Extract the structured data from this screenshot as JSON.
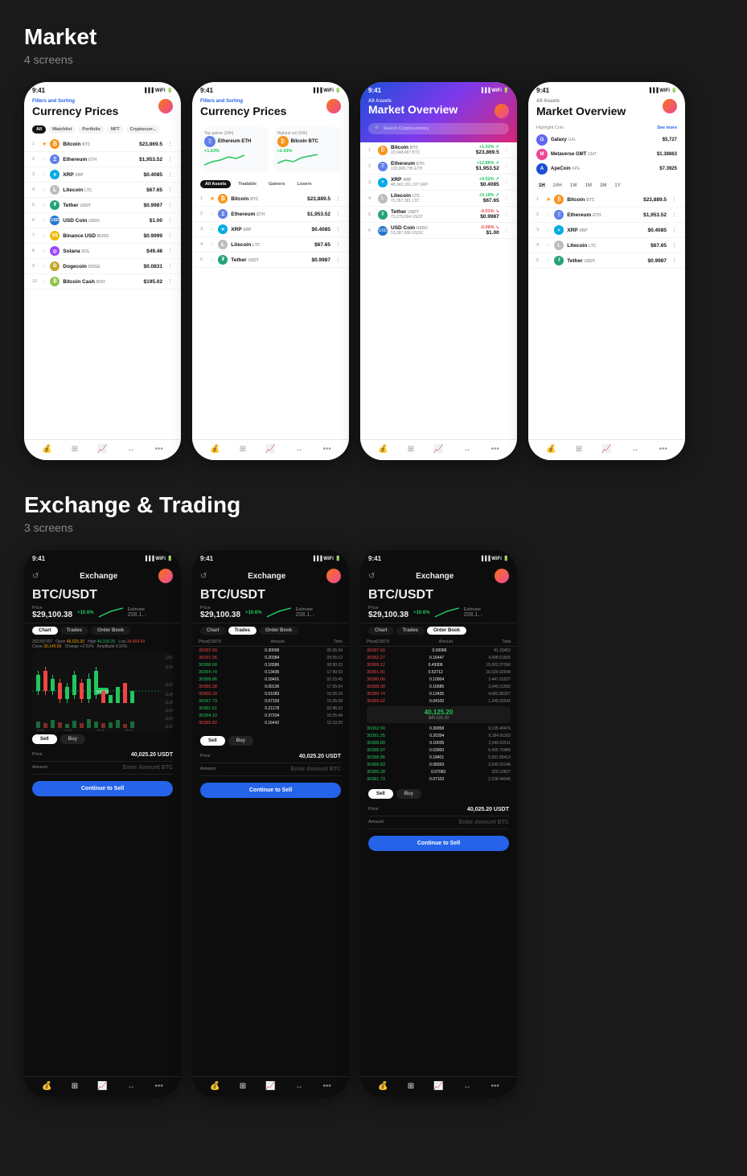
{
  "market": {
    "section_title": "Market",
    "section_subtitle": "4 screens",
    "screen1": {
      "time": "9:41",
      "filters_label": "Filters and Sorting",
      "title": "Currency Prices",
      "tabs": [
        "All",
        "Watchlist",
        "Portfolio",
        "NFT",
        "Cryptocurr..."
      ],
      "active_tab": "All",
      "coins": [
        {
          "num": 1,
          "star": true,
          "name": "Bitcoin",
          "ticker": "BTC",
          "price": "$23,869.5",
          "color": "btc"
        },
        {
          "num": 2,
          "star": false,
          "name": "Ethereum",
          "ticker": "ETH",
          "price": "$1,953.52",
          "color": "eth"
        },
        {
          "num": 3,
          "star": false,
          "name": "XRP",
          "ticker": "XRP",
          "price": "$0.4085",
          "color": "xrp"
        },
        {
          "num": 4,
          "star": false,
          "name": "Litecoin",
          "ticker": "LTC",
          "price": "$67.65",
          "color": "ltc"
        },
        {
          "num": 5,
          "star": false,
          "name": "Tether",
          "ticker": "USDT",
          "price": "$0.9987",
          "color": "usdt"
        },
        {
          "num": 6,
          "star": false,
          "name": "USD Coin",
          "ticker": "USDC",
          "price": "$1.00",
          "color": "usdc"
        },
        {
          "num": 7,
          "star": false,
          "name": "Binance USD",
          "ticker": "BUSD",
          "price": "$0.9999",
          "color": "busd"
        },
        {
          "num": 8,
          "star": false,
          "name": "Solana",
          "ticker": "SOL",
          "price": "$49.48",
          "color": "sol"
        },
        {
          "num": 9,
          "star": false,
          "name": "Dogecoin",
          "ticker": "DOGE",
          "price": "$0.0831",
          "color": "doge"
        },
        {
          "num": 10,
          "star": false,
          "name": "Bitcoin Cash",
          "ticker": "BCH",
          "price": "$195.02",
          "color": "bch"
        }
      ]
    },
    "screen2": {
      "time": "9:41",
      "filters_label": "Filters and Sorting",
      "title": "Currency Prices",
      "gainer_label": "Top gainer (24h)",
      "highest_vol_label": "Highest vol (24h)",
      "gainer": {
        "name": "Ethereum",
        "ticker": "ETH",
        "change": "+1.53%"
      },
      "highest_vol": {
        "name": "Bitcoin",
        "ticker": "BTC",
        "change": "+2.43%"
      },
      "filter_tabs": [
        "All Assets",
        "Tradable",
        "Gainers",
        "Losers"
      ],
      "active_filter": "All Assets",
      "coins": [
        {
          "num": 1,
          "star": true,
          "name": "Bitcoin",
          "ticker": "BTC",
          "price": "$23,889.5"
        },
        {
          "num": 2,
          "star": false,
          "name": "Ethereum",
          "ticker": "ETH",
          "price": "$1,953.52"
        },
        {
          "num": 3,
          "star": false,
          "name": "XRP",
          "ticker": "XRP",
          "price": "$0.4085"
        },
        {
          "num": 4,
          "star": false,
          "name": "Litecoin",
          "ticker": "LTC",
          "price": "$67.65"
        },
        {
          "num": 5,
          "star": false,
          "name": "Tether",
          "ticker": "USDT",
          "price": "$0.9987"
        }
      ]
    },
    "screen3": {
      "time": "9:41",
      "all_assets_label": "All Assets",
      "title": "Market Overview",
      "search_placeholder": "Search Cryptocurrency",
      "coins": [
        {
          "num": 1,
          "name": "Bitcoin",
          "ticker": "BTC",
          "supply": "19,048,487 BTC",
          "price": "$23,869.5",
          "change": "+1.53%"
        },
        {
          "num": 2,
          "name": "Ethereum",
          "ticker": "ETH",
          "supply": "120,908,795 ETH",
          "price": "$1,953.52",
          "change": "+12.86%"
        },
        {
          "num": 3,
          "name": "XRP",
          "ticker": "XRP",
          "supply": "48,343,101,197 XRP",
          "price": "$0.4085",
          "change": "+9.52%"
        },
        {
          "num": 4,
          "name": "Litecoin",
          "ticker": "LTC",
          "supply": "70,357,381 LTC",
          "price": "$67.65",
          "change": "+5.18%"
        },
        {
          "num": 5,
          "name": "Tether",
          "ticker": "USDT",
          "supply": "73,275,094 USDT",
          "price": "$0.9987",
          "change": "-0.01%"
        },
        {
          "num": 6,
          "name": "USD Coin",
          "ticker": "USDC",
          "supply": "53,287,606 USDC",
          "price": "$1.00",
          "change": "-0.06%"
        }
      ]
    },
    "screen4": {
      "time": "9:41",
      "all_assets_label": "All Assets",
      "title": "Market Overview",
      "highlight_label": "Highlight Coin",
      "see_more": "See more",
      "highlights": [
        {
          "name": "Galaxy",
          "ticker": "GAL",
          "price": "$5,727",
          "color": "gal"
        },
        {
          "name": "Metaverse GMT",
          "ticker": "GMT",
          "price": "$1.38863",
          "color": "mtv"
        },
        {
          "name": "ApeCoin",
          "ticker": "APE",
          "price": "$7.3925",
          "color": "ape"
        }
      ],
      "time_tabs": [
        "1H",
        "24H",
        "1W",
        "1M",
        "3M",
        "1Y"
      ],
      "active_time": "1H",
      "coins": [
        {
          "num": 1,
          "star": true,
          "name": "Bitcoin",
          "ticker": "BTC",
          "price": "$23,889.5"
        },
        {
          "num": 2,
          "star": false,
          "name": "Ethereum",
          "ticker": "ETH",
          "price": "$1,953.52"
        },
        {
          "num": 3,
          "star": false,
          "name": "XRP",
          "ticker": "XRP",
          "price": "$0.4085"
        },
        {
          "num": 4,
          "star": false,
          "name": "Litecoin",
          "ticker": "LTC",
          "price": "$67.65"
        },
        {
          "num": 5,
          "star": false,
          "name": "Tether",
          "ticker": "USDT",
          "price": "$0.9987"
        }
      ]
    }
  },
  "exchange": {
    "section_title": "Exchange & Trading",
    "section_subtitle": "3 screens",
    "screen1": {
      "time": "9:41",
      "header": "Exchange",
      "pair": "BTC/USDT",
      "price": "$29,100.38",
      "change": "+10.6%",
      "estimate": "208.1...",
      "price_label": "Price",
      "estimate_label": "Estimate",
      "tabs": [
        "Chart",
        "Trades",
        "Order Book"
      ],
      "active_tab": "Chart",
      "chart_date": "2022/07/07",
      "chart_info": "Open 46,025.20  High 44,315.20  Low 34,504.93\nClose 30,145.50  Change +2.52%  Amplitude 6.56%",
      "sell_label": "Sell",
      "buy_label": "Buy",
      "active_side": "Sell",
      "price_value": "40,025.20 USDT",
      "amount_placeholder": "Enter Amount BTC",
      "cta": "Continue to Sell"
    },
    "screen2": {
      "time": "9:41",
      "header": "Exchange",
      "pair": "BTC/USDT",
      "price": "$29,100.38",
      "change": "+10.6%",
      "estimate": "208.1...",
      "tabs": [
        "Chart",
        "Trades",
        "Order Book"
      ],
      "active_tab": "Trades",
      "trades_headers": [
        "Price(USDT)",
        "Amount",
        "Time"
      ],
      "trades": [
        {
          "price": "30282.69",
          "amount": "0.30058",
          "time": "05:25:34",
          "side": "sell"
        },
        {
          "price": "30291.05",
          "amount": "0.20384",
          "time": "09:35:12",
          "side": "sell"
        },
        {
          "price": "30388.00",
          "amount": "0.16586",
          "time": "08:50:23",
          "side": "buy"
        },
        {
          "price": "30394.74",
          "amount": "0.13435",
          "time": "17:40:33",
          "side": "buy"
        },
        {
          "price": "30388.86",
          "amount": "0.18401",
          "time": "02:15:45",
          "side": "buy"
        },
        {
          "price": "30386.28",
          "amount": "0.00136",
          "time": "17:35:54",
          "side": "sell"
        },
        {
          "price": "30366.29",
          "amount": "0.01083",
          "time": "10:35:18",
          "side": "sell"
        },
        {
          "price": "30347.73",
          "amount": "0.07103",
          "time": "15:35:28",
          "side": "buy"
        },
        {
          "price": "30381.61",
          "amount": "0.21178",
          "time": "02:45:32",
          "side": "buy"
        },
        {
          "price": "30394.10",
          "amount": "0.37204",
          "time": "16:25:49",
          "side": "buy"
        },
        {
          "price": "30385.82",
          "amount": "0.16442",
          "time": "12:10:25",
          "side": "sell"
        }
      ],
      "sell_label": "Sell",
      "buy_label": "Buy",
      "active_side": "Sell",
      "price_value": "40,025.20 USDT",
      "amount_placeholder": "Enter Amount BTC",
      "cta": "Continue to Sell"
    },
    "screen3": {
      "time": "9:41",
      "header": "Exchange",
      "pair": "BTC/USDT",
      "price": "$29,100.38",
      "change": "+10.6%",
      "estimate": "208.1...",
      "tabs": [
        "Chart",
        "Trades",
        "Order Book"
      ],
      "active_tab": "Order Book",
      "sells": [
        {
          "price": "30387.60",
          "amount": "0.00086",
          "total": "41.33452"
        },
        {
          "price": "30392.27",
          "amount": "0.16447",
          "total": "4,998.61665"
        },
        {
          "price": "30389.12",
          "amount": "0.49306",
          "total": "15,003.37396"
        },
        {
          "price": "30391.81",
          "amount": "0.52712",
          "total": "16,020.02548"
        },
        {
          "price": "30390.00",
          "amount": "0.10004",
          "total": "3,447.01527"
        },
        {
          "price": "30388.00",
          "amount": "0.16586",
          "total": "3,049.21560"
        },
        {
          "price": "30389.74",
          "amount": "0.13435",
          "total": "4,082.86157"
        },
        {
          "price": "30389.62",
          "amount": "0.04100",
          "total": "1,245.93342"
        }
      ],
      "mid_price": "40,125.20",
      "mid_price_sub": "$40,025.20",
      "buys": [
        {
          "price": "30392.50",
          "amount": "0.30058",
          "total": "9,135.40476"
        },
        {
          "price": "30391.35",
          "amount": "0.20394",
          "total": "6,184.91163"
        },
        {
          "price": "30388.89",
          "amount": "0.10035",
          "total": "3,049.52511"
        },
        {
          "price": "30388.97",
          "amount": "0.03000",
          "total": "6,435.75489"
        },
        {
          "price": "30388.86",
          "amount": "0.18401",
          "total": "5,591.85413"
        },
        {
          "price": "30386.83",
          "amount": "0.08359",
          "total": "2,540.20146"
        },
        {
          "price": "30386.28",
          "amount": "0.07083",
          "total": "329.10507"
        },
        {
          "price": "30381.73",
          "amount": "0.07103",
          "total": "2,158.44046"
        }
      ],
      "sell_label": "Sell",
      "buy_label": "Buy",
      "active_side": "Sell",
      "price_value": "40,025.20 USDT",
      "amount_placeholder": "Enter Amount BTC",
      "cta": "Continue to Sell"
    }
  },
  "nav_icons": {
    "wallet": "💰",
    "chart": "📊",
    "trend": "📈",
    "transfer": "↔",
    "more": "•••"
  }
}
